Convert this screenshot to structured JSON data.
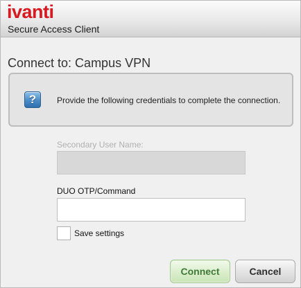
{
  "header": {
    "logo_text": "ivanti",
    "subtitle": "Secure Access Client"
  },
  "main": {
    "connect_title": "Connect to: Campus VPN",
    "info_message": "Provide the following credentials to complete the connection.",
    "info_icon": "help-question-icon",
    "secondary_username": {
      "label": "Secondary User Name:",
      "value": "",
      "disabled": true
    },
    "duo_otp": {
      "label": "DUO OTP/Command",
      "value": ""
    },
    "save_settings": {
      "label": "Save settings",
      "checked": false
    }
  },
  "buttons": {
    "connect": "Connect",
    "cancel": "Cancel"
  },
  "colors": {
    "brand_red": "#d71920",
    "connect_text": "#3f7a36",
    "connect_bg": "#dcefcf",
    "help_icon_blue": "#4a8cc8"
  }
}
